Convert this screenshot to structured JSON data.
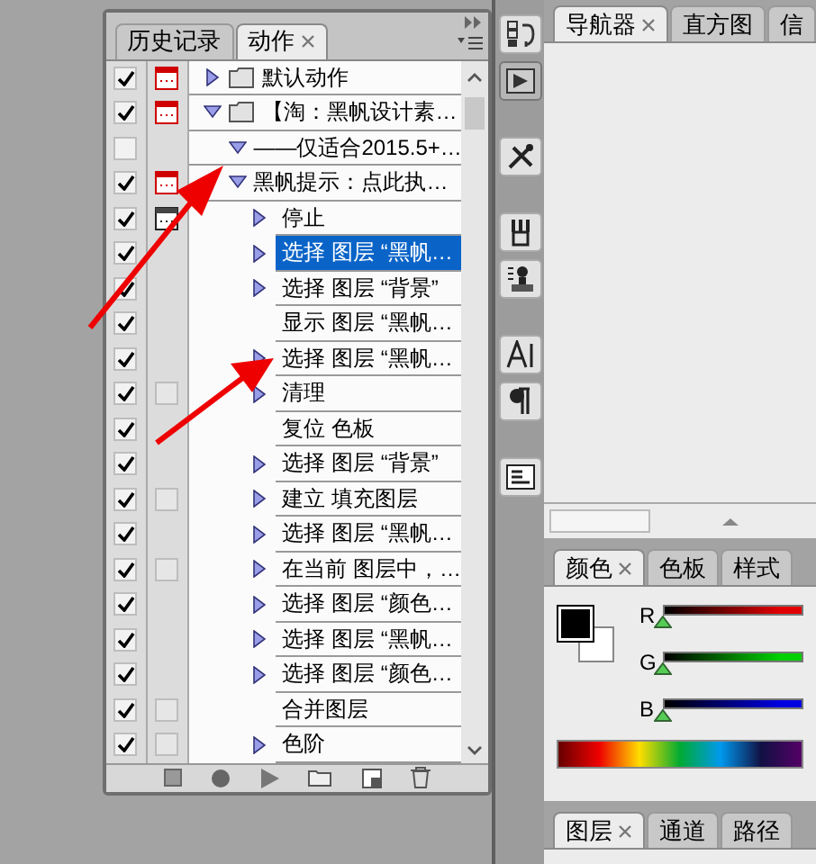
{
  "actions_panel": {
    "tabs": [
      {
        "label": "历史记录",
        "selected": false
      },
      {
        "label": "动作",
        "selected": true
      }
    ],
    "items": [
      {
        "kind": "set",
        "name": "默认动作",
        "checked": true,
        "dialog": true,
        "expanded": false,
        "selected": false
      },
      {
        "kind": "set",
        "name": "【淘：黑帆设计素…",
        "checked": true,
        "dialog": true,
        "expanded": true,
        "selected": false,
        "children": [
          {
            "kind": "action",
            "name": "——仅适合2015.5+…",
            "checked": false,
            "expanded": true,
            "selected": false
          },
          {
            "kind": "action",
            "name": "黑帆提示：点此执…",
            "checked": true,
            "dialog": true,
            "expanded": true,
            "selected": false,
            "children": [
              {
                "kind": "command",
                "name": "停止",
                "checked": true,
                "dialog": true,
                "dialog_partial": true,
                "expanded": false,
                "selected": false
              },
              {
                "kind": "command",
                "name": "选择 图层 “黑帆…",
                "checked": true,
                "expanded": false,
                "selected": true
              },
              {
                "kind": "command",
                "name": "选择 图层 “背景”",
                "checked": true,
                "expanded": false,
                "selected": false
              },
              {
                "kind": "command",
                "name": "显示 图层 “黑帆…",
                "checked": true,
                "selected": false
              },
              {
                "kind": "command",
                "name": "选择 图层 “黑帆…",
                "checked": true,
                "expanded": false,
                "selected": false
              },
              {
                "kind": "command",
                "name": "清理",
                "checked": true,
                "dialog": false,
                "expanded": false,
                "selected": false
              },
              {
                "kind": "command",
                "name": "复位 色板",
                "checked": true,
                "selected": false
              },
              {
                "kind": "command",
                "name": "选择 图层 “背景”",
                "checked": true,
                "expanded": false,
                "selected": false
              },
              {
                "kind": "command",
                "name": "建立 填充图层",
                "checked": true,
                "dialog": false,
                "expanded": false,
                "selected": false
              },
              {
                "kind": "command",
                "name": "选择 图层 “黑帆…",
                "checked": true,
                "expanded": false,
                "selected": false
              },
              {
                "kind": "command",
                "name": "在当前 图层中，…",
                "checked": true,
                "dialog": false,
                "expanded": false,
                "selected": false
              },
              {
                "kind": "command",
                "name": "选择 图层 “颜色…",
                "checked": true,
                "expanded": false,
                "selected": false
              },
              {
                "kind": "command",
                "name": "选择 图层 “黑帆…",
                "checked": true,
                "expanded": false,
                "selected": false
              },
              {
                "kind": "command",
                "name": "选择 图层 “颜色…",
                "checked": true,
                "expanded": false,
                "selected": false
              },
              {
                "kind": "command",
                "name": "合并图层",
                "checked": true,
                "dialog": false,
                "selected": false
              },
              {
                "kind": "command",
                "name": "色阶",
                "checked": true,
                "dialog": false,
                "expanded": false,
                "selected": false
              }
            ]
          }
        ]
      }
    ]
  },
  "navigator_panel": {
    "tabs": [
      {
        "label": "导航器",
        "selected": true
      },
      {
        "label": "直方图",
        "selected": false
      },
      {
        "label": "信",
        "selected": false
      }
    ]
  },
  "color_panel": {
    "tabs": [
      {
        "label": "颜色",
        "selected": true
      },
      {
        "label": "色板",
        "selected": false
      },
      {
        "label": "样式",
        "selected": false
      }
    ],
    "sliders": [
      {
        "label": "R",
        "color": "#e00000",
        "level": 0
      },
      {
        "label": "G",
        "color": "#00d000",
        "level": 0
      },
      {
        "label": "B",
        "color": "#0000e0",
        "level": 0
      }
    ]
  },
  "layers_panel": {
    "tabs": [
      {
        "label": "图层",
        "selected": true
      },
      {
        "label": "通道",
        "selected": false
      },
      {
        "label": "路径",
        "selected": false
      }
    ]
  }
}
